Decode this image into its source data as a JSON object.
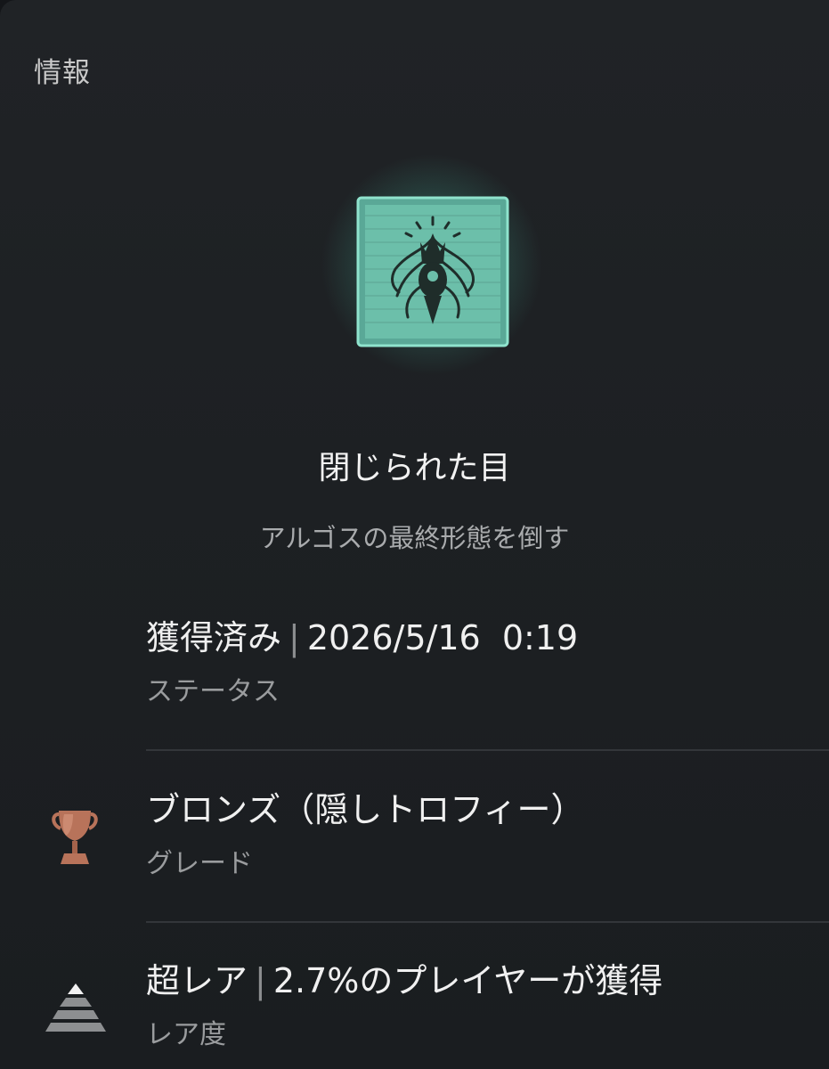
{
  "header": {
    "label": "情報"
  },
  "trophy": {
    "title": "閉じられた目",
    "description": "アルゴスの最終形態を倒す",
    "icon": "trophy-art-icon",
    "glow_color": "#5fd3b6"
  },
  "status": {
    "value_main": "獲得済み",
    "value_separator": "|",
    "value_date": "2026/5/16  0:19",
    "label": "ステータス"
  },
  "grade": {
    "value": "ブロンズ（隠しトロフィー）",
    "label": "グレード",
    "icon": "bronze-trophy-icon",
    "color": "#b8735a"
  },
  "rarity": {
    "value_main": "超レア",
    "value_separator": "|",
    "value_detail": "2.7%のプレイヤーが獲得",
    "label": "レア度",
    "icon": "rarity-pyramid-icon"
  }
}
